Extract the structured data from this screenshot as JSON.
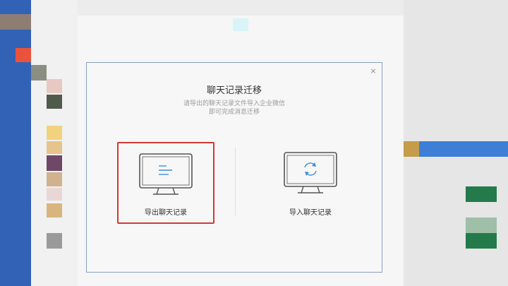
{
  "dialog": {
    "title": "聊天记录迁移",
    "description_line1": "请导出的聊天记录文件导入企业微信",
    "description_line2": "即可完成消息迁移",
    "close_symbol": "×"
  },
  "options": {
    "export": {
      "label": "导出聊天记录",
      "icon": "monitor-lines-icon",
      "selected": true
    },
    "import": {
      "label": "导入聊天记录",
      "icon": "monitor-sync-icon",
      "selected": false
    }
  },
  "colors": {
    "sidebar": "#3262b5",
    "highlight": "#d13a36",
    "accent": "#e9533b"
  }
}
